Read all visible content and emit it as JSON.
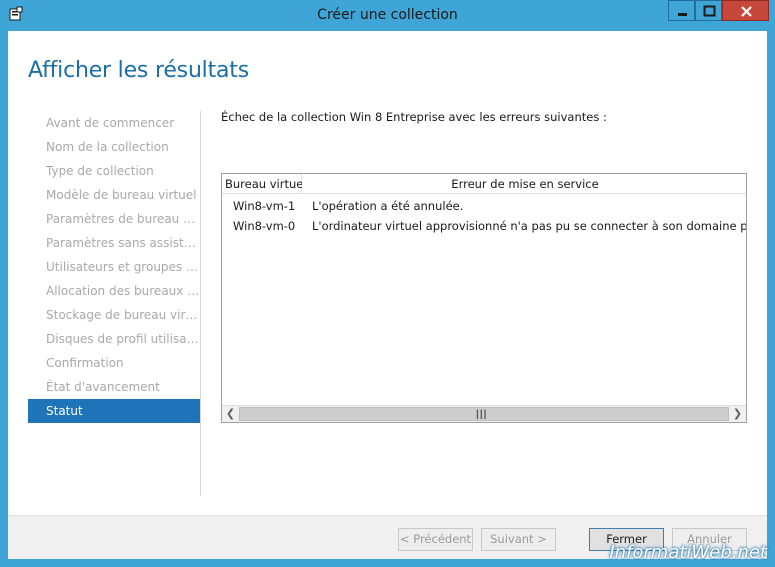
{
  "window": {
    "title": "Créer une collection"
  },
  "page": {
    "heading": "Afficher les résultats",
    "message": "Échec de la collection Win 8 Entreprise avec les erreurs suivantes :"
  },
  "nav": {
    "items": [
      {
        "label": "Avant de commencer"
      },
      {
        "label": "Nom de la collection"
      },
      {
        "label": "Type de collection"
      },
      {
        "label": "Modèle de bureau virtuel"
      },
      {
        "label": "Paramètres de bureau virt..."
      },
      {
        "label": "Paramètres sans assistance"
      },
      {
        "label": "Utilisateurs et groupes d'..."
      },
      {
        "label": "Allocation des bureaux vir..."
      },
      {
        "label": "Stockage de bureau virtuel"
      },
      {
        "label": "Disques de profil utilisateur"
      },
      {
        "label": "Confirmation"
      },
      {
        "label": "État d'avancement"
      },
      {
        "label": "Statut"
      }
    ],
    "active_index": 12
  },
  "table": {
    "columns": [
      "Bureau virtuel",
      "Erreur de mise en service"
    ],
    "rows": [
      {
        "vm": "Win8-vm-1",
        "error": "L'opération a été annulée."
      },
      {
        "vm": "Win8-vm-0",
        "error": "L'ordinateur virtuel approvisionné n'a pas pu se connecter à son domaine principa"
      }
    ]
  },
  "buttons": {
    "previous": "< Précédent",
    "next": "Suivant >",
    "close": "Fermer",
    "cancel": "Annuler"
  },
  "watermark": "InformatiWeb.net",
  "colors": {
    "frame": "#3fa4d6",
    "heading": "#1b6fa6",
    "nav_active": "#1f74b9",
    "close_button": "#c7473b"
  }
}
